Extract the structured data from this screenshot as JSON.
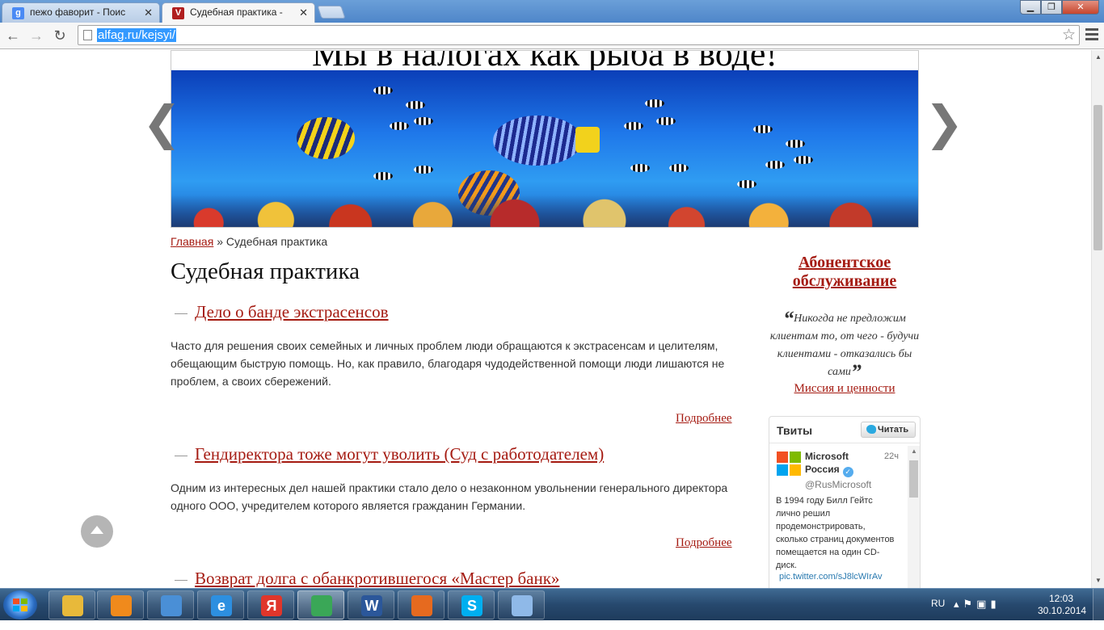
{
  "browser": {
    "tabs": [
      {
        "title": "пежо фаворит - Поиск в",
        "favicon": "google-icon",
        "color": "#4a8af4"
      },
      {
        "title": "Судебная практика - Пра",
        "favicon": "site-shield-icon",
        "color": "#b01e1e"
      }
    ],
    "url": "alfag.ru/kejsyi/"
  },
  "site": {
    "slogan": "Мы в налогах как рыба в воде!",
    "breadcrumb": {
      "home": "Главная",
      "separator": "»",
      "current": "Судебная практика"
    },
    "page_title": "Судебная практика",
    "articles": [
      {
        "title": "Дело о банде экстрасенсов",
        "text": "Часто для решения своих семейных и личных проблем люди обращаются к экстрасенсам и целителям, обещающим быструю помощь. Но, как правило, благодаря чудодейственной помощи люди лишаются не проблем, а своих сбережений.",
        "more": "Подробнее"
      },
      {
        "title": "Гендиректора тоже могут уволить (Суд с работодателем)",
        "text": "Одним из интересных дел нашей практики стало дело о незаконном увольнении генерального директора одного ООО, учредителем которого является гражданин Германии.",
        "more": "Подробнее"
      },
      {
        "title": "Возврат долга с обанкротившегося «Мастер банк»"
      }
    ],
    "sidebar": {
      "subscription": "Абонентское обслуживание",
      "quote_open": "“",
      "quote": "Никогда не предложим клиентам то, от чего - будучи клиентами - отказались бы сами",
      "quote_close": "”",
      "mission_link": "Миссия и ценности"
    },
    "twitter": {
      "title": "Твиты",
      "follow": "Читать",
      "account_name": "Microsoft Россия",
      "handle": "@RusMicrosoft",
      "time": "22ч",
      "text": "В 1994 году Билл Гейтс лично решил продемонстрировать, сколько страниц документов помещается на один CD-диск.",
      "link": "pic.twitter.com/sJ8lcWIrAv"
    }
  },
  "taskbar": {
    "apps": [
      {
        "name": "explorer-icon",
        "label": "",
        "color": "#e8b93a"
      },
      {
        "name": "media-player-icon",
        "label": "",
        "color": "#f08a1c"
      },
      {
        "name": "volume-app-icon",
        "label": "",
        "color": "#4a8fd6"
      },
      {
        "name": "internet-explorer-icon",
        "label": "e",
        "color": "#2d8fe0"
      },
      {
        "name": "yandex-browser-icon",
        "label": "Я",
        "color": "#e0362b"
      },
      {
        "name": "chrome-icon",
        "label": "",
        "color": "#3aa757"
      },
      {
        "name": "word-icon",
        "label": "W",
        "color": "#2b579a"
      },
      {
        "name": "firefox-icon",
        "label": "",
        "color": "#e66a1f"
      },
      {
        "name": "skype-icon",
        "label": "S",
        "color": "#00aff0"
      },
      {
        "name": "paint-icon",
        "label": "",
        "color": "#8fb9e8"
      }
    ],
    "language": "RU",
    "time": "12:03",
    "date": "30.10.2014"
  }
}
